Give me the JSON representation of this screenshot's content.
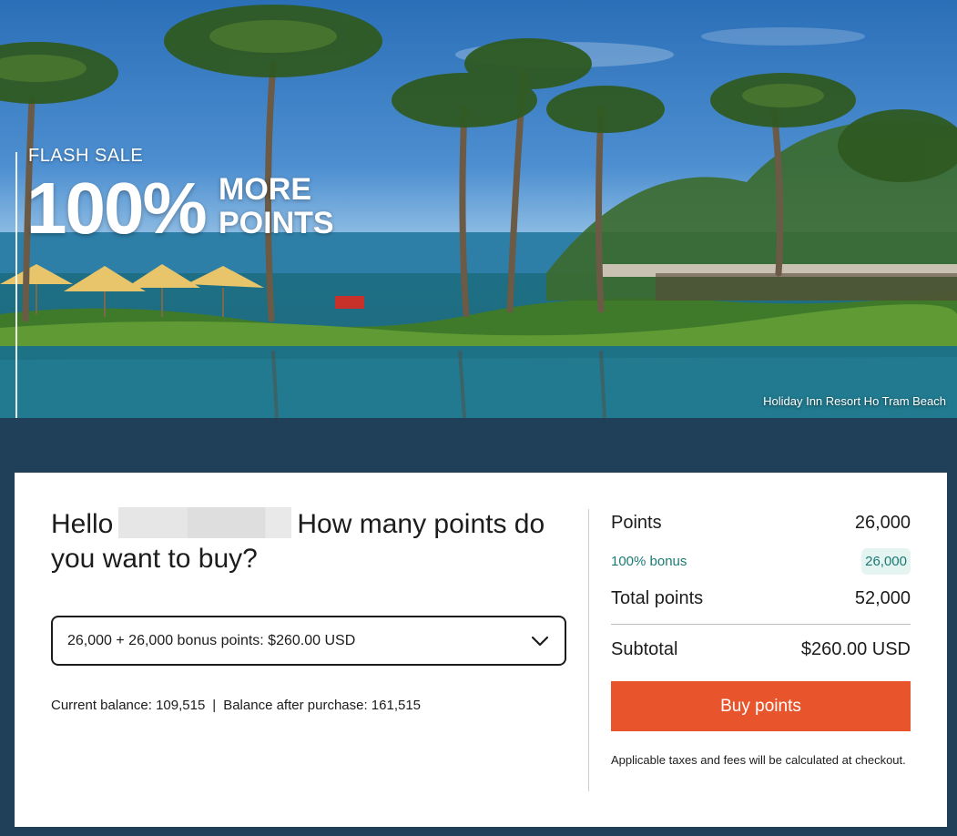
{
  "hero": {
    "eyebrow": "FLASH SALE",
    "big": "100%",
    "stack_line1": "MORE",
    "stack_line2": "POINTS",
    "caption": "Holiday Inn Resort Ho Tram Beach"
  },
  "purchase": {
    "greeting_prefix": "Hello",
    "greeting_question": "How many points do you want to buy?",
    "select_value": "26,000 + 26,000 bonus points: $260.00 USD",
    "balance_current_label": "Current balance: 109,515",
    "balance_separator": "|",
    "balance_after_label": "Balance after purchase: 161,515"
  },
  "summary": {
    "points_label": "Points",
    "points_value": "26,000",
    "bonus_label": "100% bonus",
    "bonus_value": "26,000",
    "total_label": "Total points",
    "total_value": "52,000",
    "subtotal_label": "Subtotal",
    "subtotal_value": "$260.00 USD",
    "buy_label": "Buy points",
    "note": "Applicable taxes and fees will be calculated at checkout."
  },
  "colors": {
    "page_bg": "#1f4058",
    "accent_button": "#e8552c",
    "bonus_text": "#1b7a73",
    "bonus_bg": "#e4f4f1"
  },
  "icons": {
    "select_caret": "chevron-down-icon"
  }
}
